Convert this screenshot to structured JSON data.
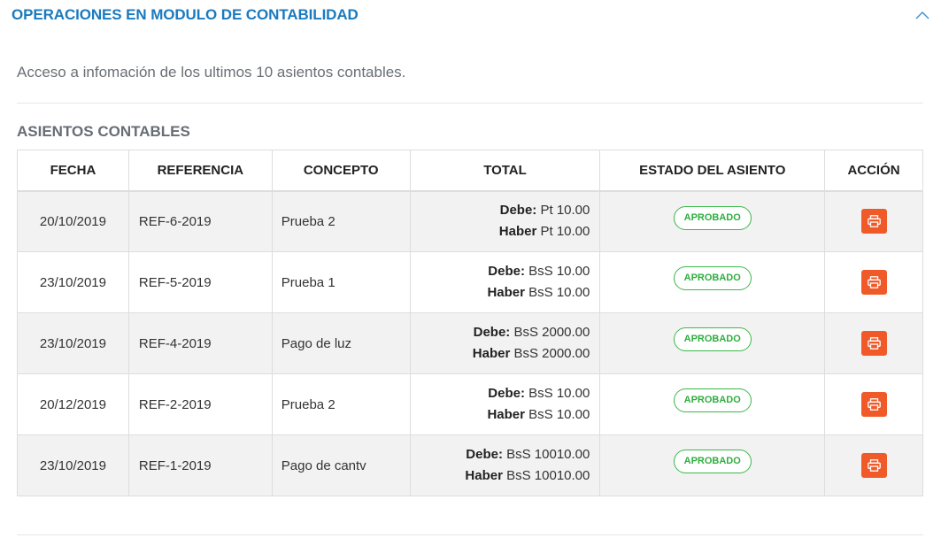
{
  "panel": {
    "title": "OPERACIONES EN MODULO DE CONTABILIDAD",
    "intro": "Acceso a infomación de los ultimos 10 asientos contables.",
    "section_title": "ASIENTOS CONTABLES"
  },
  "icons": {
    "collapse": "chevron-up-icon",
    "print": "print-icon"
  },
  "colors": {
    "title": "#1a7abf",
    "badge": "#2fae3f",
    "print_button": "#f05a28"
  },
  "table": {
    "headers": [
      "FECHA",
      "REFERENCIA",
      "CONCEPTO",
      "TOTAL",
      "ESTADO DEL ASIENTO",
      "ACCIÓN"
    ],
    "debe_label": "Debe:",
    "haber_label": "Haber",
    "rows": [
      {
        "fecha": "20/10/2019",
        "referencia": "REF-6-2019",
        "concepto": "Prueba 2",
        "debe": "Pt 10.00",
        "haber": "Pt 10.00",
        "estado": "APROBADO"
      },
      {
        "fecha": "23/10/2019",
        "referencia": "REF-5-2019",
        "concepto": "Prueba 1",
        "debe": "BsS 10.00",
        "haber": "BsS 10.00",
        "estado": "APROBADO"
      },
      {
        "fecha": "23/10/2019",
        "referencia": "REF-4-2019",
        "concepto": "Pago de luz",
        "debe": "BsS 2000.00",
        "haber": "BsS 2000.00",
        "estado": "APROBADO"
      },
      {
        "fecha": "20/12/2019",
        "referencia": "REF-2-2019",
        "concepto": "Prueba 2",
        "debe": "BsS 10.00",
        "haber": "BsS 10.00",
        "estado": "APROBADO"
      },
      {
        "fecha": "23/10/2019",
        "referencia": "REF-1-2019",
        "concepto": "Pago de cantv",
        "debe": "BsS 10010.00",
        "haber": "BsS 10010.00",
        "estado": "APROBADO"
      }
    ]
  }
}
